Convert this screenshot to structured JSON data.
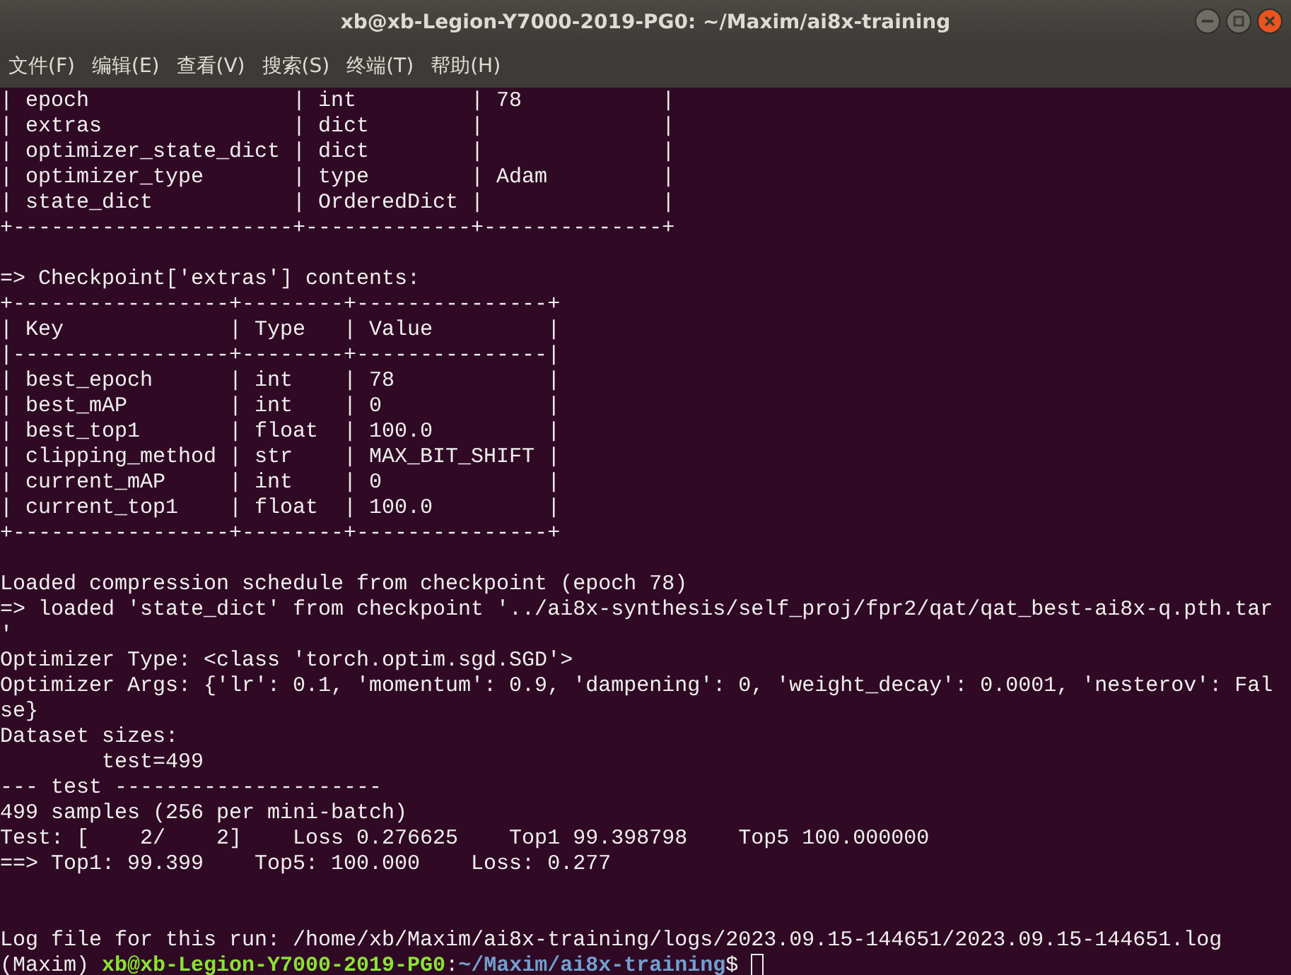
{
  "window": {
    "title": "xb@xb-Legion-Y7000-2019-PG0: ~/Maxim/ai8x-training"
  },
  "menu": [
    "文件(F)",
    "编辑(E)",
    "查看(V)",
    "搜索(S)",
    "终端(T)",
    "帮助(H)"
  ],
  "terminal": {
    "lines": [
      {
        "kind": "text",
        "text": "| epoch                | int         | 78           |"
      },
      {
        "kind": "text",
        "text": "| extras               | dict        |              |"
      },
      {
        "kind": "text",
        "text": "| optimizer_state_dict | dict        |              |"
      },
      {
        "kind": "text",
        "text": "| optimizer_type       | type        | Adam         |"
      },
      {
        "kind": "text",
        "text": "| state_dict           | OrderedDict |              |"
      },
      {
        "kind": "text",
        "text": "+----------------------+-------------+--------------+"
      },
      {
        "kind": "blank"
      },
      {
        "kind": "text",
        "text": "=> Checkpoint['extras'] contents:"
      },
      {
        "kind": "text",
        "text": "+-----------------+--------+---------------+"
      },
      {
        "kind": "text",
        "text": "| Key             | Type   | Value         |"
      },
      {
        "kind": "text",
        "text": "|-----------------+--------+---------------|"
      },
      {
        "kind": "text",
        "text": "| best_epoch      | int    | 78            |"
      },
      {
        "kind": "text",
        "text": "| best_mAP        | int    | 0             |"
      },
      {
        "kind": "text",
        "text": "| best_top1       | float  | 100.0         |"
      },
      {
        "kind": "text",
        "text": "| clipping_method | str    | MAX_BIT_SHIFT |"
      },
      {
        "kind": "text",
        "text": "| current_mAP     | int    | 0             |"
      },
      {
        "kind": "text",
        "text": "| current_top1    | float  | 100.0         |"
      },
      {
        "kind": "text",
        "text": "+-----------------+--------+---------------+"
      },
      {
        "kind": "blank"
      },
      {
        "kind": "text",
        "text": "Loaded compression schedule from checkpoint (epoch 78)"
      },
      {
        "kind": "text",
        "text": "=> loaded 'state_dict' from checkpoint '../ai8x-synthesis/self_proj/fpr2/qat/qat_best-ai8x-q.pth.tar"
      },
      {
        "kind": "text",
        "text": "'"
      },
      {
        "kind": "text",
        "text": "Optimizer Type: <class 'torch.optim.sgd.SGD'>"
      },
      {
        "kind": "text",
        "text": "Optimizer Args: {'lr': 0.1, 'momentum': 0.9, 'dampening': 0, 'weight_decay': 0.0001, 'nesterov': Fal"
      },
      {
        "kind": "text",
        "text": "se}"
      },
      {
        "kind": "text",
        "text": "Dataset sizes:"
      },
      {
        "kind": "text",
        "text": "        test=499"
      },
      {
        "kind": "text",
        "text": "--- test ---------------------"
      },
      {
        "kind": "text",
        "text": "499 samples (256 per mini-batch)"
      },
      {
        "kind": "text",
        "text": "Test: [    2/    2]    Loss 0.276625    Top1 99.398798    Top5 100.000000"
      },
      {
        "kind": "text",
        "text": "==> Top1: 99.399    Top5: 100.000    Loss: 0.277"
      },
      {
        "kind": "blank"
      },
      {
        "kind": "blank"
      },
      {
        "kind": "text",
        "text": "Log file for this run: /home/xb/Maxim/ai8x-training/logs/2023.09.15-144651/2023.09.15-144651.log"
      }
    ],
    "prompt": [
      {
        "kind": "plain",
        "text": "(Maxim) "
      },
      {
        "kind": "user",
        "text": "xb@xb-Legion-Y7000-2019-PG0"
      },
      {
        "kind": "plain",
        "text": ":"
      },
      {
        "kind": "path",
        "text": "~/Maxim/ai8x-training"
      },
      {
        "kind": "plain",
        "text": "$ "
      }
    ]
  }
}
